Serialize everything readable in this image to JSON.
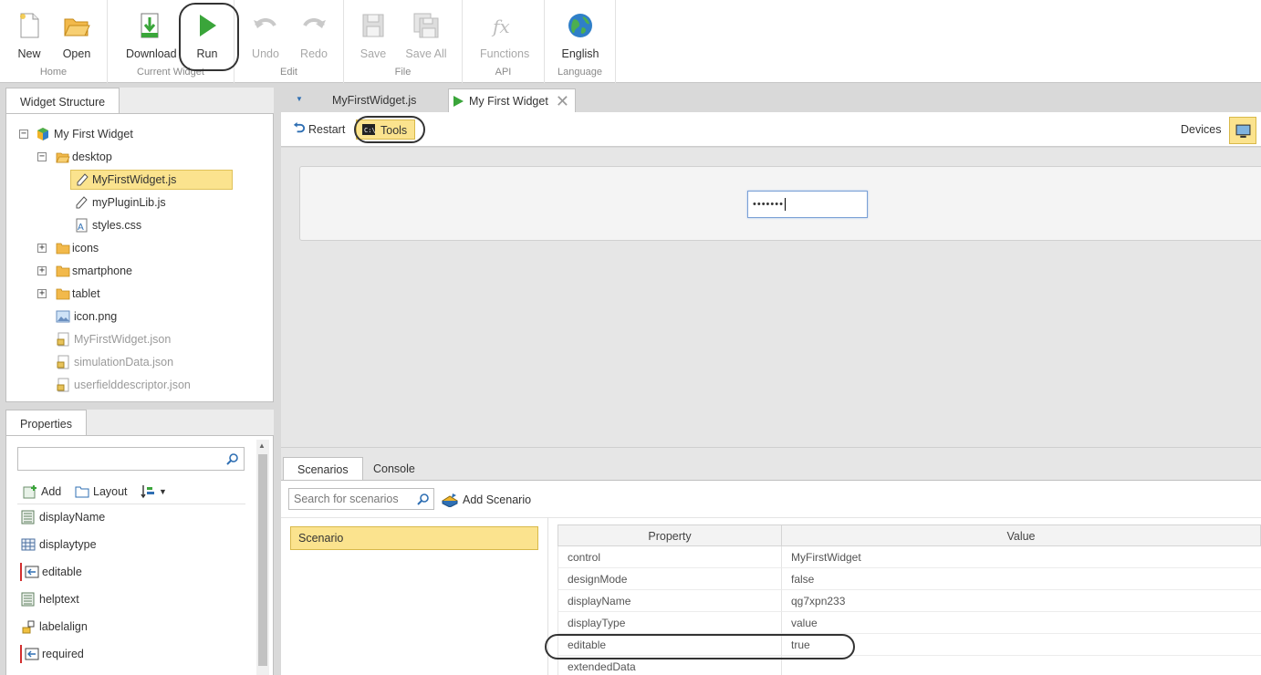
{
  "ribbon": {
    "groups": [
      {
        "label": "Home",
        "buttons": [
          {
            "label": "New"
          },
          {
            "label": "Open"
          }
        ]
      },
      {
        "label": "Current Widget",
        "buttons": [
          {
            "label": "Download"
          },
          {
            "label": "Run"
          }
        ]
      },
      {
        "label": "Edit",
        "buttons": [
          {
            "label": "Undo"
          },
          {
            "label": "Redo"
          }
        ]
      },
      {
        "label": "File",
        "buttons": [
          {
            "label": "Save"
          },
          {
            "label": "Save All"
          }
        ]
      },
      {
        "label": "API",
        "buttons": [
          {
            "label": "Functions"
          }
        ]
      },
      {
        "label": "Language",
        "buttons": [
          {
            "label": "English"
          }
        ]
      }
    ]
  },
  "structure": {
    "tab": "Widget Structure",
    "items": [
      {
        "label": "My First Widget"
      },
      {
        "label": "desktop"
      },
      {
        "label": "MyFirstWidget.js"
      },
      {
        "label": "myPluginLib.js"
      },
      {
        "label": "styles.css"
      },
      {
        "label": "icons"
      },
      {
        "label": "smartphone"
      },
      {
        "label": "tablet"
      },
      {
        "label": "icon.png"
      },
      {
        "label": "MyFirstWidget.json"
      },
      {
        "label": "simulationData.json"
      },
      {
        "label": "userfielddescriptor.json"
      }
    ]
  },
  "properties": {
    "tab": "Properties",
    "add_label": "Add",
    "layout_label": "Layout",
    "items": [
      "displayName",
      "displaytype",
      "editable",
      "helptext",
      "labelalign",
      "required"
    ]
  },
  "editor": {
    "tabs": [
      "MyFirstWidget.js",
      "My First Widget"
    ],
    "restart_label": "Restart",
    "tools_label": "Tools",
    "devices_label": "Devices",
    "password_value": "•••••••"
  },
  "bottom": {
    "tabs": [
      "Scenarios",
      "Console"
    ],
    "search_placeholder": "Search for scenarios",
    "add_scenario_label": "Add Scenario",
    "scenario_item": "Scenario",
    "table": {
      "headers": [
        "Property",
        "Value"
      ],
      "rows": [
        {
          "property": "control",
          "value": "MyFirstWidget"
        },
        {
          "property": "designMode",
          "value": "false"
        },
        {
          "property": "displayName",
          "value": "qg7xpn233"
        },
        {
          "property": "displayType",
          "value": "value"
        },
        {
          "property": "editable",
          "value": "true"
        },
        {
          "property": "extendedData",
          "value": ""
        }
      ]
    }
  },
  "colors": {
    "selection": "#fbe38e",
    "run_green": "#3aa53a",
    "accent_blue": "#2f6fb3"
  }
}
